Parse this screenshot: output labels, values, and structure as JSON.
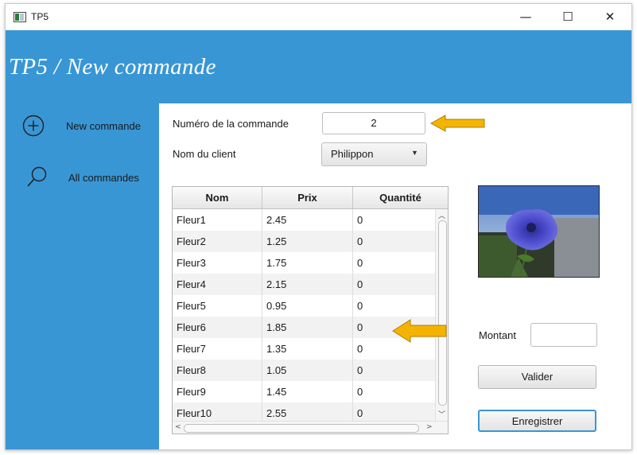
{
  "window": {
    "title": "TP5",
    "minimize_glyph": "—",
    "maximize_glyph": "☐",
    "close_glyph": "✕"
  },
  "header": {
    "title": "TP5 / New commande"
  },
  "sidebar": {
    "items": [
      {
        "label": "New commande",
        "icon": "add-circle-icon"
      },
      {
        "label": "All commandes",
        "icon": "search-icon"
      }
    ]
  },
  "form": {
    "order_number_label": "Numéro de la commande",
    "order_number_value": "2",
    "client_label": "Nom du client",
    "client_value": "Philippon"
  },
  "table": {
    "columns": [
      "Nom",
      "Prix",
      "Quantité"
    ],
    "rows": [
      [
        "Fleur1",
        "2.45",
        "0"
      ],
      [
        "Fleur2",
        "1.25",
        "0"
      ],
      [
        "Fleur3",
        "1.75",
        "0"
      ],
      [
        "Fleur4",
        "2.15",
        "0"
      ],
      [
        "Fleur5",
        "0.95",
        "0"
      ],
      [
        "Fleur6",
        "1.85",
        "0"
      ],
      [
        "Fleur7",
        "1.35",
        "0"
      ],
      [
        "Fleur8",
        "1.05",
        "0"
      ],
      [
        "Fleur9",
        "1.45",
        "0"
      ],
      [
        "Fleur10",
        "2.55",
        "0"
      ]
    ]
  },
  "montant": {
    "label": "Montant",
    "value": ""
  },
  "buttons": {
    "valider": "Valider",
    "enregistrer": "Enregistrer"
  },
  "colors": {
    "accent": "#3996d5",
    "annotation_arrow": "#f5b301"
  }
}
